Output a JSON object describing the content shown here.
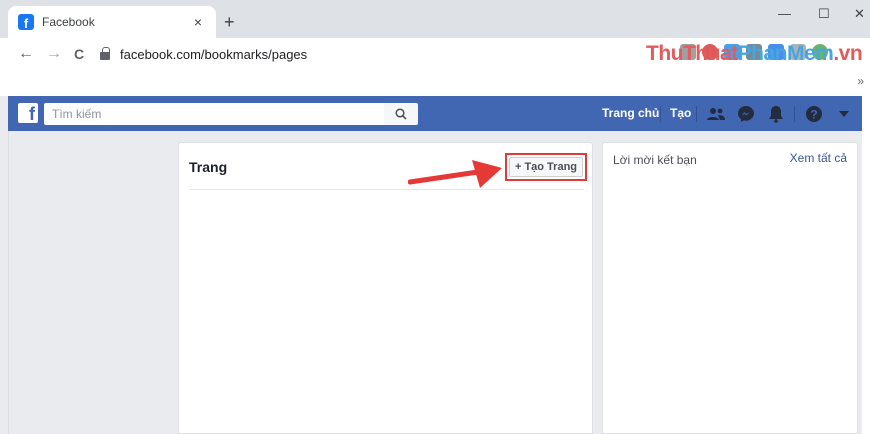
{
  "browser": {
    "tab_title": "Facebook",
    "tab_close": "×",
    "new_tab": "+",
    "url": "facebook.com/bookmarks/pages",
    "minimize": "—",
    "maximize": "☐",
    "close": "✕",
    "back": "←",
    "forward": "→",
    "reload": "C",
    "more_bookmarks": "»",
    "favicon_letter": "f"
  },
  "watermark": {
    "part1": "ThuThuat",
    "part2": "PhanMem",
    "part3": ".vn"
  },
  "fb_header": {
    "logo_letter": "f",
    "search_placeholder": "Tìm kiếm",
    "home_label": "Trang chủ",
    "create_label": "Tạo"
  },
  "pages_card": {
    "title": "Trang",
    "create_button": "+ Tạo Trang"
  },
  "friends_card": {
    "title": "Lời mời kết bạn",
    "see_all": "Xem tất cả"
  },
  "colors": {
    "fb_blue": "#4267b2",
    "highlight_red": "#e03a3a",
    "arrow_red": "#e53935"
  }
}
